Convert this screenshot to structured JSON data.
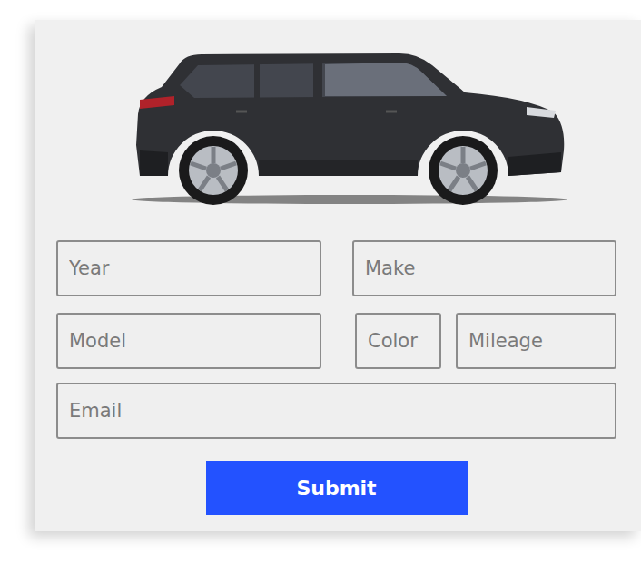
{
  "form": {
    "fields": [
      {
        "placeholder": "Year"
      },
      {
        "placeholder": "Make"
      },
      {
        "placeholder": "Model"
      },
      {
        "placeholder": "Color"
      },
      {
        "placeholder": "Mileage"
      },
      {
        "placeholder": "Email"
      }
    ],
    "submit": "Submit"
  }
}
